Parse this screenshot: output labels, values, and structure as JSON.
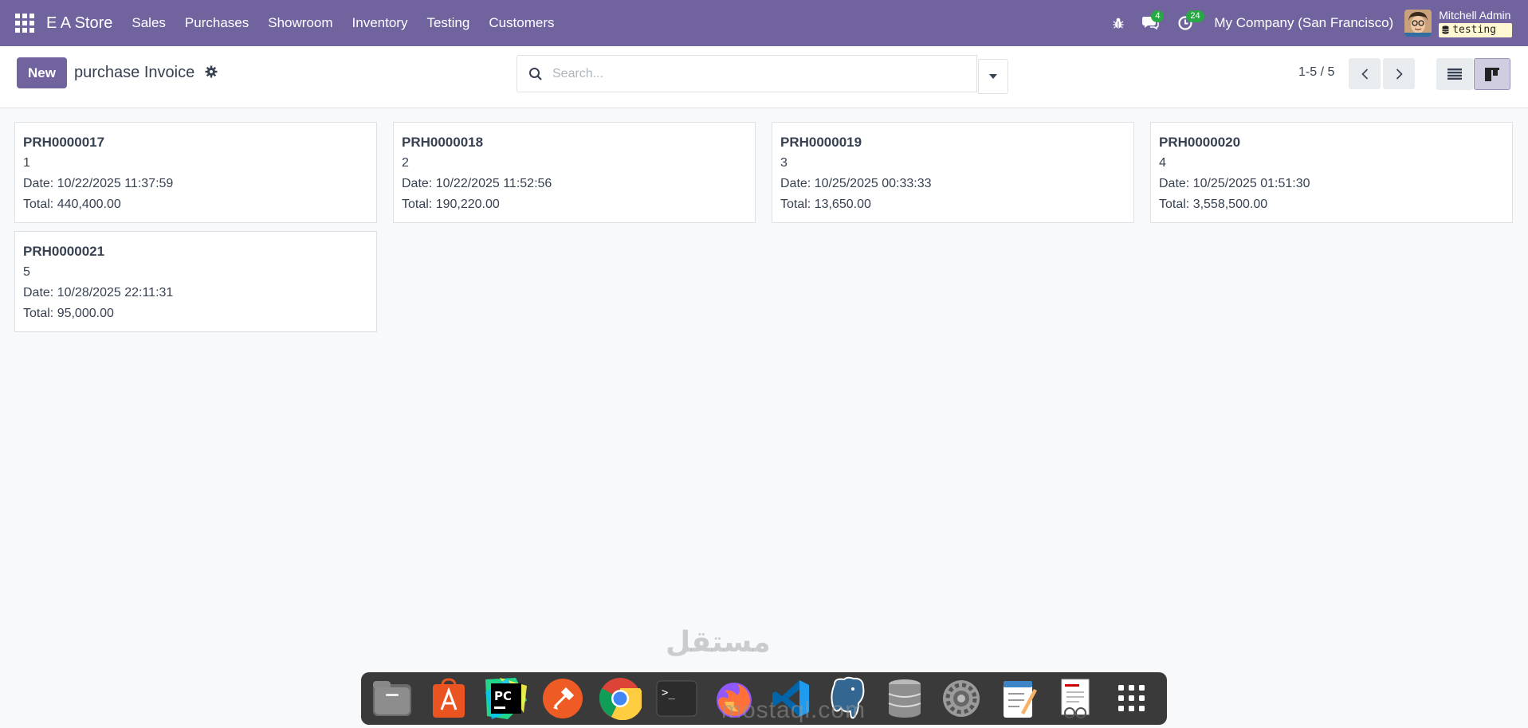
{
  "navbar": {
    "brand": "E A Store",
    "menu": [
      "Sales",
      "Purchases",
      "Showroom",
      "Inventory",
      "Testing",
      "Customers"
    ],
    "messages_count": "4",
    "activities_count": "24",
    "company": "My Company (San Francisco)",
    "user_name": "Mitchell Admin",
    "database": "testing"
  },
  "control": {
    "new_label": "New",
    "title": "purchase Invoice",
    "search_placeholder": "Search...",
    "pager": "1-5 / 5"
  },
  "cards": [
    {
      "ref": "PRH0000017",
      "seq": "1",
      "date": "Date: 10/22/2025 11:37:59",
      "total": "Total: 440,400.00"
    },
    {
      "ref": "PRH0000018",
      "seq": "2",
      "date": "Date: 10/22/2025 11:52:56",
      "total": "Total: 190,220.00"
    },
    {
      "ref": "PRH0000019",
      "seq": "3",
      "date": "Date: 10/25/2025 00:33:33",
      "total": "Total: 13,650.00"
    },
    {
      "ref": "PRH0000020",
      "seq": "4",
      "date": "Date: 10/25/2025 01:51:30",
      "total": "Total: 3,558,500.00"
    },
    {
      "ref": "PRH0000021",
      "seq": "5",
      "date": "Date: 10/28/2025 22:11:31",
      "total": "Total: 95,000.00"
    }
  ],
  "dock": {
    "icons": [
      "files-icon",
      "app-store-icon",
      "pycharm-icon",
      "postman-icon",
      "chrome-icon",
      "terminal-icon",
      "firefox-icon",
      "vscode-icon",
      "postgres-icon",
      "database-icon",
      "settings-icon",
      "text-editor-icon",
      "document-viewer-icon",
      "app-grid-icon"
    ],
    "terminal_glyph": ">_",
    "pycharm_glyph": "PC"
  },
  "watermark": {
    "arabic": "مستقل",
    "latin": "mostaql.com"
  },
  "colors": {
    "brand": "#71639e",
    "badge": "#28a745",
    "background": "#f8f9fa"
  }
}
